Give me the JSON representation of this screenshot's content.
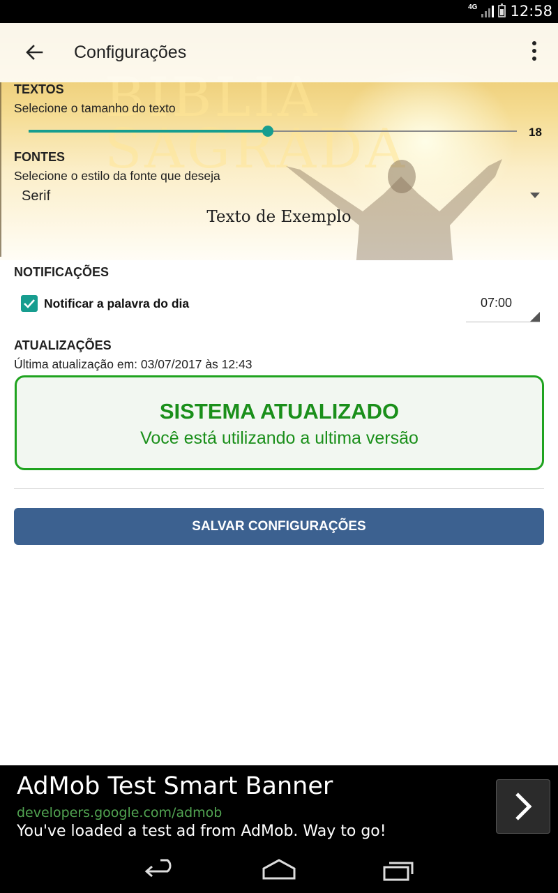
{
  "status_bar": {
    "network": "4G",
    "time": "12:58"
  },
  "app_bar": {
    "title": "Configurações"
  },
  "hero": {
    "watermark_line1": "BIBLIA",
    "watermark_line2": "SAGRADA"
  },
  "texts_section": {
    "title": "TEXTOS",
    "subtitle": "Selecione o tamanho do texto",
    "slider_value": "18",
    "slider_fraction": 0.49
  },
  "fonts_section": {
    "title": "FONTES",
    "subtitle": "Selecione o estilo da fonte que deseja",
    "selected_font": "Serif",
    "sample_text": "Texto de Exemplo"
  },
  "notifications_section": {
    "title": "NOTIFICAÇÕES",
    "checkbox_label": "Notificar a palavra do dia",
    "checked": true,
    "time": "07:00"
  },
  "updates_section": {
    "title": "ATUALIZAÇÕES",
    "last_update": "Última atualização em: 03/07/2017 às 12:43",
    "status_title": "SISTEMA ATUALIZADO",
    "status_message": "Você está utilizando a ultima versão"
  },
  "save_button": {
    "label": "SALVAR CONFIGURAÇÕES"
  },
  "ad": {
    "title": "AdMob Test Smart Banner",
    "url": "developers.google.com/admob",
    "text": "You've loaded a test ad from AdMob. Way to go!"
  },
  "colors": {
    "accent": "#179d8f",
    "success_green": "#1a8f1a",
    "button_blue": "#3c6190"
  },
  "icons": {
    "back": "arrow-back-icon",
    "menu": "more-vert-icon",
    "ad_arrow": "chevron-right-icon",
    "nav_back": "nav-back-icon",
    "nav_home": "nav-home-icon",
    "nav_recent": "nav-recent-icon"
  }
}
